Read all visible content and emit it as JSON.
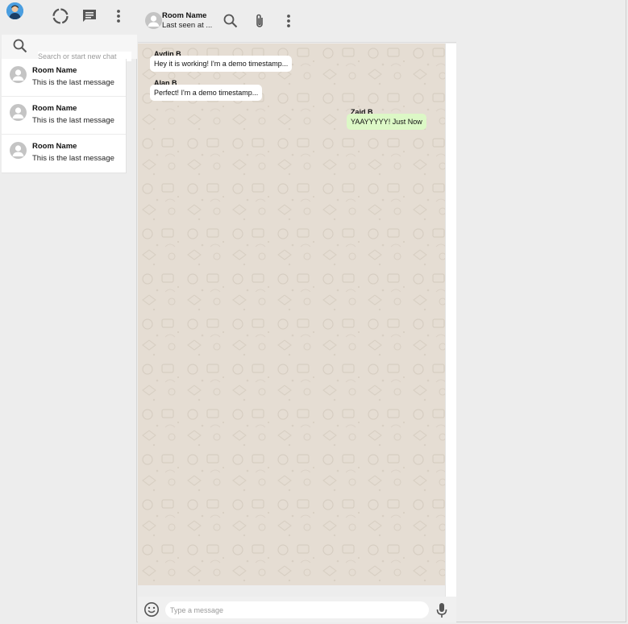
{
  "sidebar": {
    "search_placeholder": "Search or start new chat",
    "chats": [
      {
        "title": "Room Name",
        "last_message": "This is the last message"
      },
      {
        "title": "Room Name",
        "last_message": "This is the last message"
      },
      {
        "title": "Room Name",
        "last_message": "This is the last message"
      }
    ],
    "icons": [
      "user-avatar-icon",
      "status-icon",
      "chat-icon",
      "more-vert-icon",
      "search-icon"
    ]
  },
  "chat": {
    "room_name": "Room Name",
    "last_seen": "Last seen at ...",
    "icons": [
      "room-avatar-icon",
      "search-icon",
      "attach-icon",
      "more-vert-icon",
      "emoji-icon",
      "mic-icon"
    ],
    "messages": [
      {
        "name": "Aydin B",
        "text": "Hey it is working!  I'm a demo timestamp...",
        "direction": "received"
      },
      {
        "name": "Alan B",
        "text": "Perfect!  I'm a demo timestamp...",
        "direction": "received"
      },
      {
        "name": "Zaid B",
        "text": "YAAYYYYY!  Just Now",
        "direction": "sent"
      }
    ],
    "input_placeholder": "Type a message"
  },
  "colors": {
    "background": "#ededed",
    "chat_wallpaper": "#e5ddd3",
    "sent_bubble": "#dcf8c6",
    "received_bubble": "#ffffff",
    "icon": "#555555"
  }
}
